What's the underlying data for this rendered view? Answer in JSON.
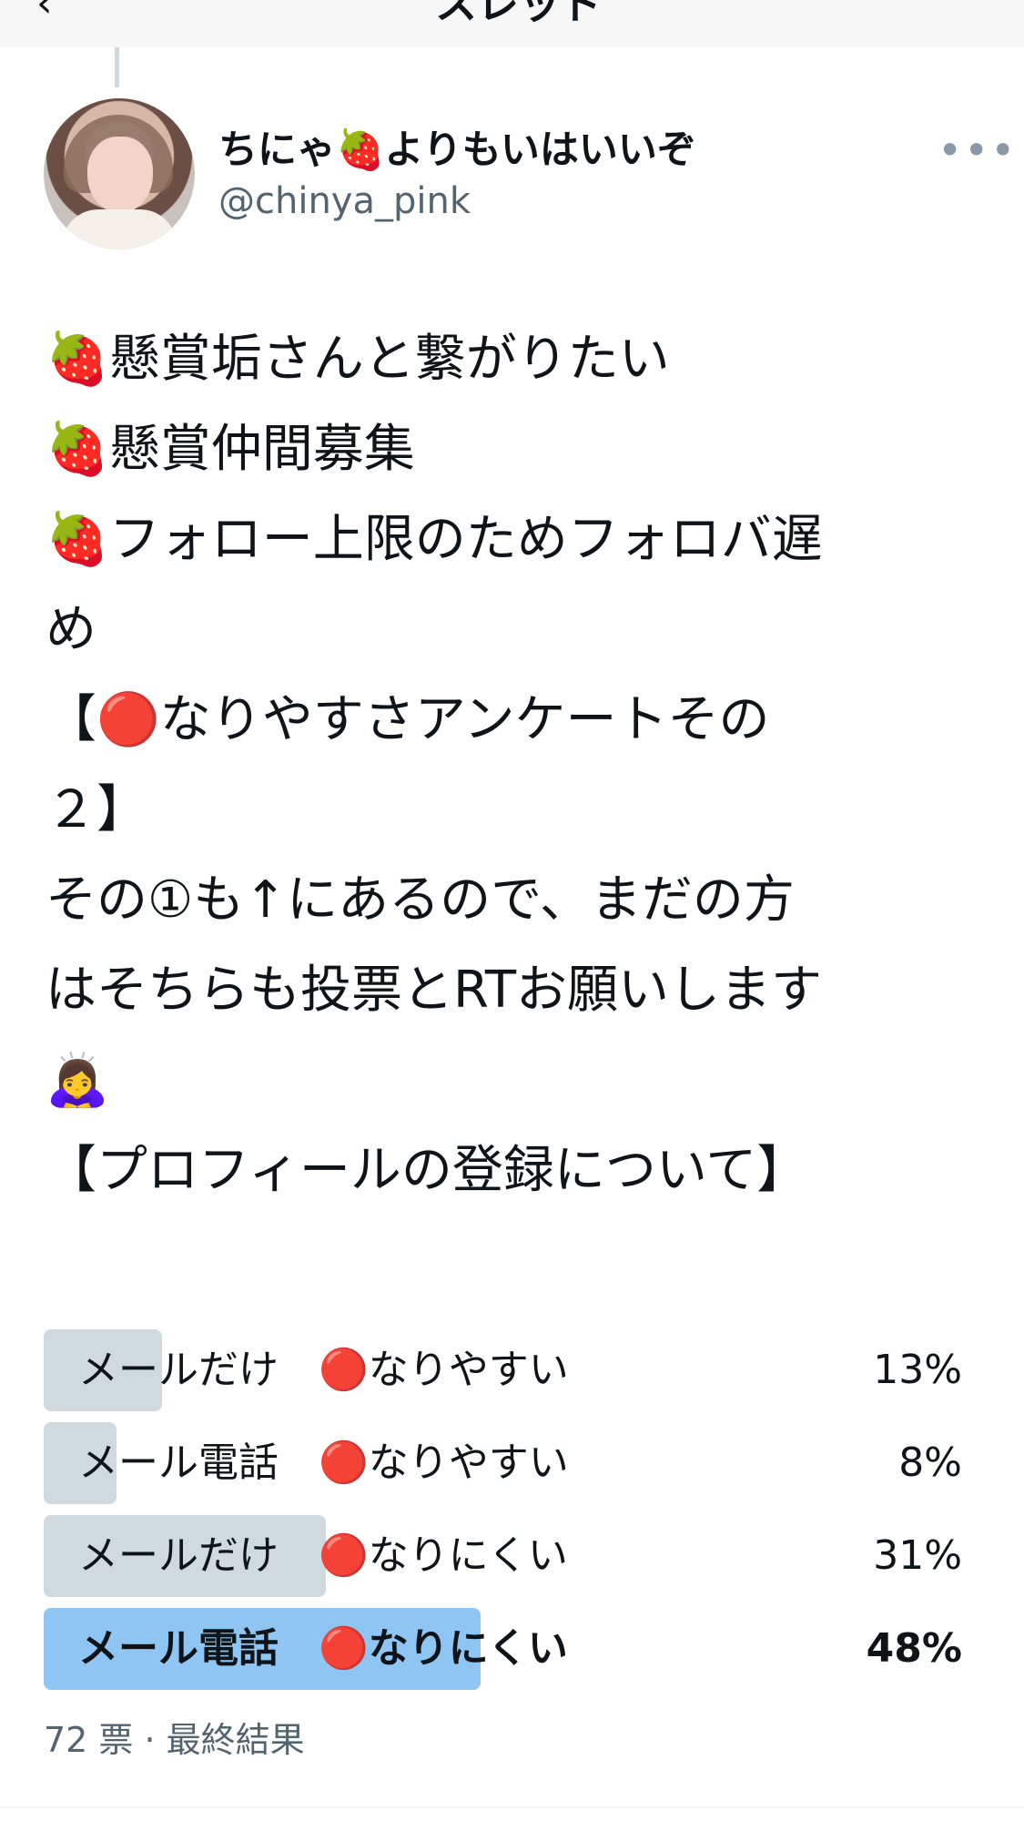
{
  "header": {
    "back_label": "‹",
    "title": "スレッド"
  },
  "author": {
    "display_name": "ちにゃ🍓よりもいはいいぞ",
    "handle": "@chinya_pink",
    "more_label": "•••"
  },
  "tweet_lines": [
    "🍓懸賞垢さんと繋がりたい",
    "🍓懸賞仲間募集",
    "🍓フォロー上限のためフォロバ遅",
    "め",
    "【🔴なりやすさアンケートその",
    "２】",
    "その①も↑にあるので、まだの方",
    "はそちらも投票とRTお願いします",
    "🙇‍♀️",
    "【プロフィールの登録について】"
  ],
  "poll": {
    "options": [
      {
        "label": "メールだけ　🔴なりやすい",
        "percent_label": "13%",
        "percent": 13,
        "winner": false
      },
      {
        "label": "メール電話　🔴なりやすい",
        "percent_label": "8%",
        "percent": 8,
        "winner": false
      },
      {
        "label": "メールだけ　🔴なりにくい",
        "percent_label": "31%",
        "percent": 31,
        "winner": false
      },
      {
        "label": "メール電話　🔴なりにくい",
        "percent_label": "48%",
        "percent": 48,
        "winner": true
      }
    ],
    "meta": "72 票 · 最終結果"
  },
  "colors": {
    "bar": "#cfd9de",
    "winner_bar": "#8ec5f2",
    "secondary_text": "#536471"
  }
}
